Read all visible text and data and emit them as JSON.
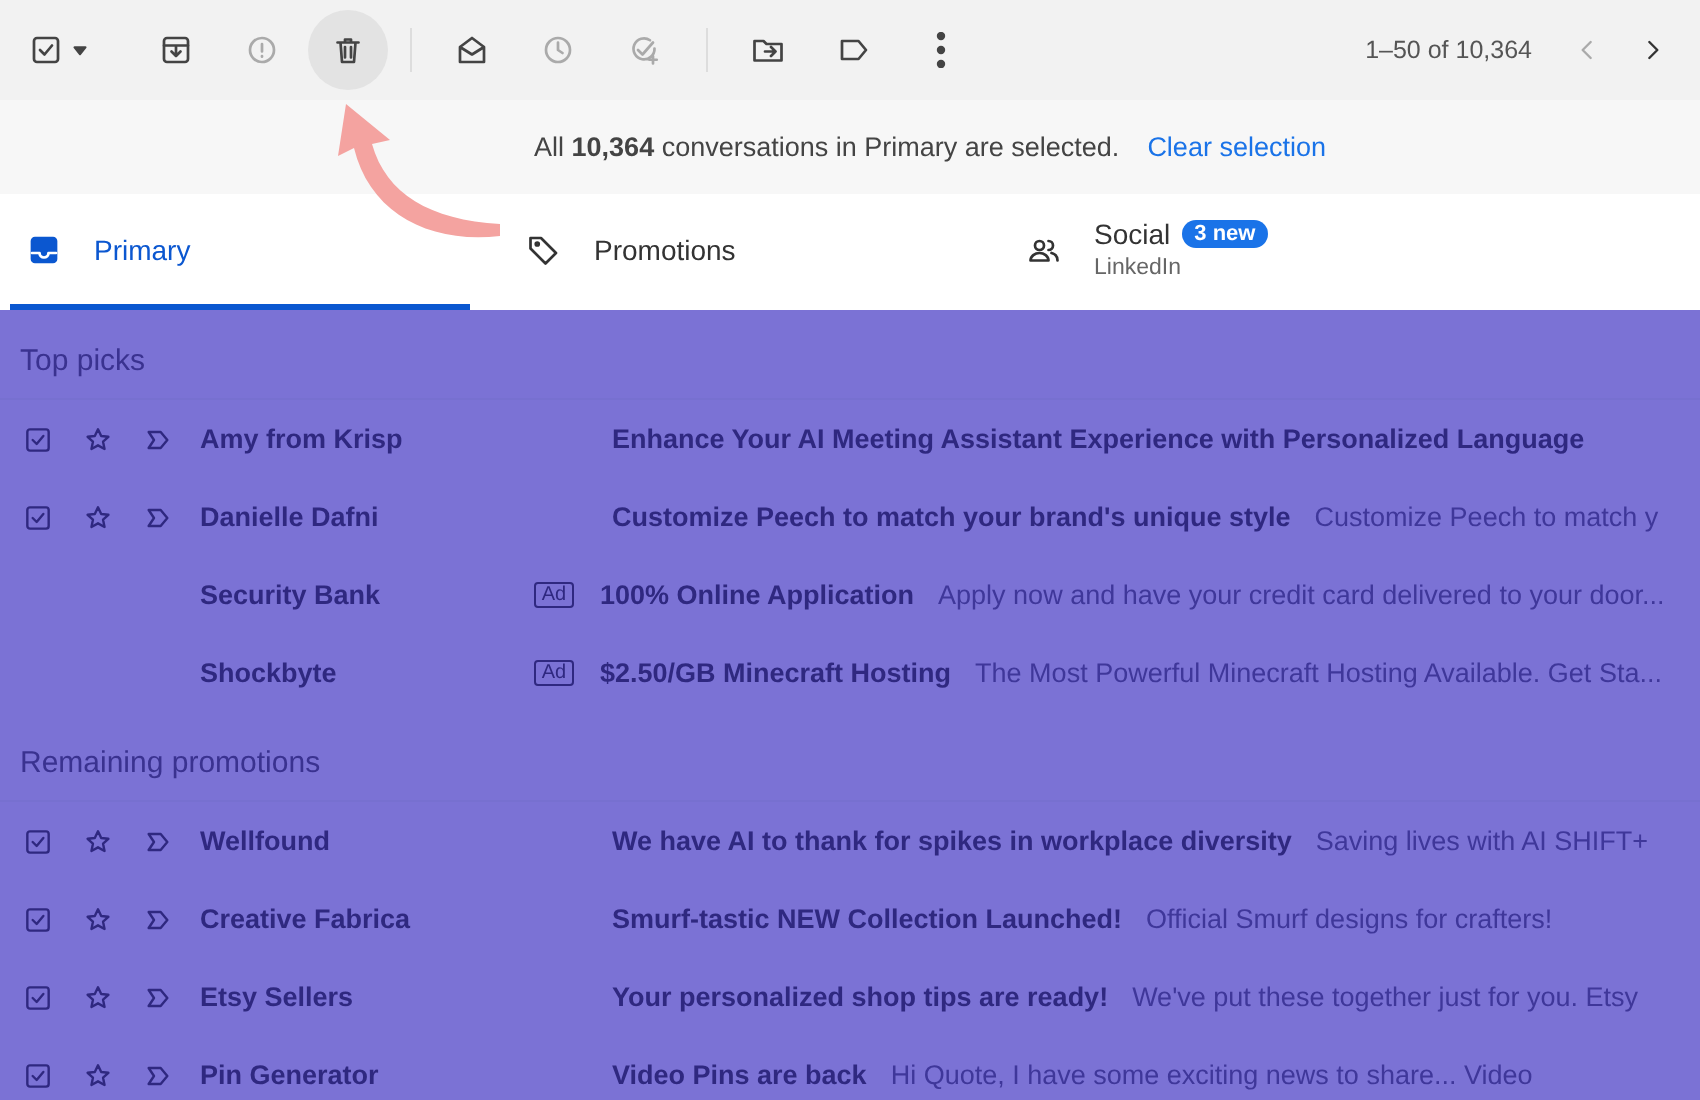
{
  "toolbar": {
    "select_all": {
      "checked": true
    },
    "actions": [
      {
        "disabled": false,
        "highlighted": false
      },
      {
        "disabled": true,
        "highlighted": false
      },
      {
        "disabled": false,
        "highlighted": true
      },
      {
        "disabled": false,
        "highlighted": false
      },
      {
        "disabled": true,
        "highlighted": false
      },
      {
        "disabled": true,
        "highlighted": false
      },
      {
        "disabled": false,
        "highlighted": false
      },
      {
        "disabled": false,
        "highlighted": false
      },
      {
        "disabled": false,
        "highlighted": false
      }
    ],
    "pagination": {
      "range": "1–50 of 10,364",
      "prev_disabled": true,
      "next_disabled": false
    }
  },
  "banner": {
    "message": "All **10,364** conversations in Primary are selected.",
    "link": "Clear selection"
  },
  "tabs": [
    {
      "label": "Primary",
      "selected": true
    },
    {
      "label": "Promotions",
      "selected": false
    },
    {
      "label": "Social",
      "badge": "3 new",
      "subtitle": "LinkedIn",
      "selected": false
    }
  ],
  "sections": [
    {
      "title": "Top picks",
      "rows": [
        {
          "kind": "email",
          "checked": true,
          "sender": "Amy from Krisp",
          "subject": "Enhance Your AI Meeting Assistant Experience with Personalized Language"
        },
        {
          "kind": "email",
          "checked": true,
          "sender": "Danielle Dafni",
          "subject": "Customize Peech to match your brand's unique style",
          "snippet": "Customize Peech to match y"
        },
        {
          "kind": "ad",
          "sender": "Security Bank",
          "badge": "Ad",
          "subject": "100% Online Application",
          "snippet": "Apply now and have your credit card delivered to your door..."
        },
        {
          "kind": "ad",
          "sender": "Shockbyte",
          "badge": "Ad",
          "subject": "$2.50/GB Minecraft Hosting",
          "snippet": "The Most Powerful Minecraft Hosting Available. Get Sta..."
        }
      ]
    },
    {
      "title": "Remaining promotions",
      "rows": [
        {
          "kind": "email",
          "checked": true,
          "sender": "Wellfound",
          "subject": "We have AI to thank for spikes in workplace diversity",
          "snippet": "Saving lives with AI SHIFT+"
        },
        {
          "kind": "email",
          "checked": true,
          "sender": "Creative Fabrica",
          "subject": "Smurf-tastic NEW Collection Launched!",
          "snippet": "Official Smurf designs for crafters!"
        },
        {
          "kind": "email",
          "checked": true,
          "sender": "Etsy Sellers",
          "subject": "Your personalized shop tips are ready!",
          "snippet": "We've put these together just for you. Etsy"
        },
        {
          "kind": "email",
          "checked": true,
          "sender": "Pin Generator",
          "subject": "Video Pins are back",
          "snippet": "Hi Quote, I have some exciting news to share... Video"
        }
      ]
    }
  ]
}
